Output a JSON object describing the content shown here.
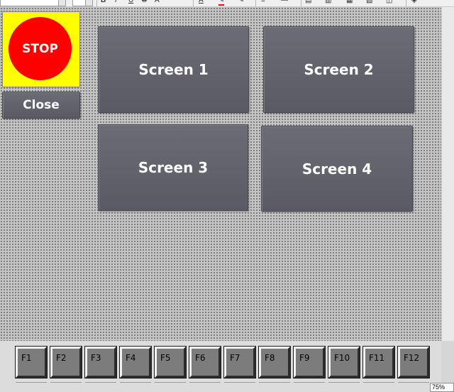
{
  "toolbar": {
    "buttons": [
      {
        "label": "B",
        "icon": "bold-icon"
      },
      {
        "label": "I",
        "icon": "italic-icon"
      },
      {
        "label": "U",
        "icon": "underline-icon"
      },
      {
        "label": "S",
        "icon": "strikethrough-icon"
      },
      {
        "label": "A",
        "icon": "text-size-icon"
      },
      {
        "label": "A",
        "icon": "font-color-icon"
      },
      {
        "label": "✎",
        "icon": "fill-color-icon"
      },
      {
        "label": "✎",
        "icon": "line-color-icon"
      },
      {
        "label": "≡",
        "icon": "line-style-icon"
      },
      {
        "label": "—",
        "icon": "line-width-icon"
      },
      {
        "label": "▤",
        "icon": "align-icon"
      },
      {
        "label": "▥",
        "icon": "distribute-icon"
      },
      {
        "label": "▦",
        "icon": "arrange-icon"
      },
      {
        "label": "▧",
        "icon": "layer-icon"
      },
      {
        "label": "◫",
        "icon": "grid-icon"
      },
      {
        "label": "◈",
        "icon": "tools-icon"
      }
    ],
    "colors": {
      "font_color_bar": "#ff0000"
    }
  },
  "stop": {
    "label": "STOP",
    "colors": {
      "panel": "#ffff00",
      "circle": "#ff0000"
    }
  },
  "buttons": {
    "close": "Close",
    "screen1": "Screen 1",
    "screen2": "Screen 2",
    "screen3": "Screen 3",
    "screen4": "Screen 4"
  },
  "function_keys": [
    "F1",
    "F2",
    "F3",
    "F4",
    "F5",
    "F6",
    "F7",
    "F8",
    "F9",
    "F10",
    "F11",
    "F12"
  ],
  "zoom": "75%"
}
